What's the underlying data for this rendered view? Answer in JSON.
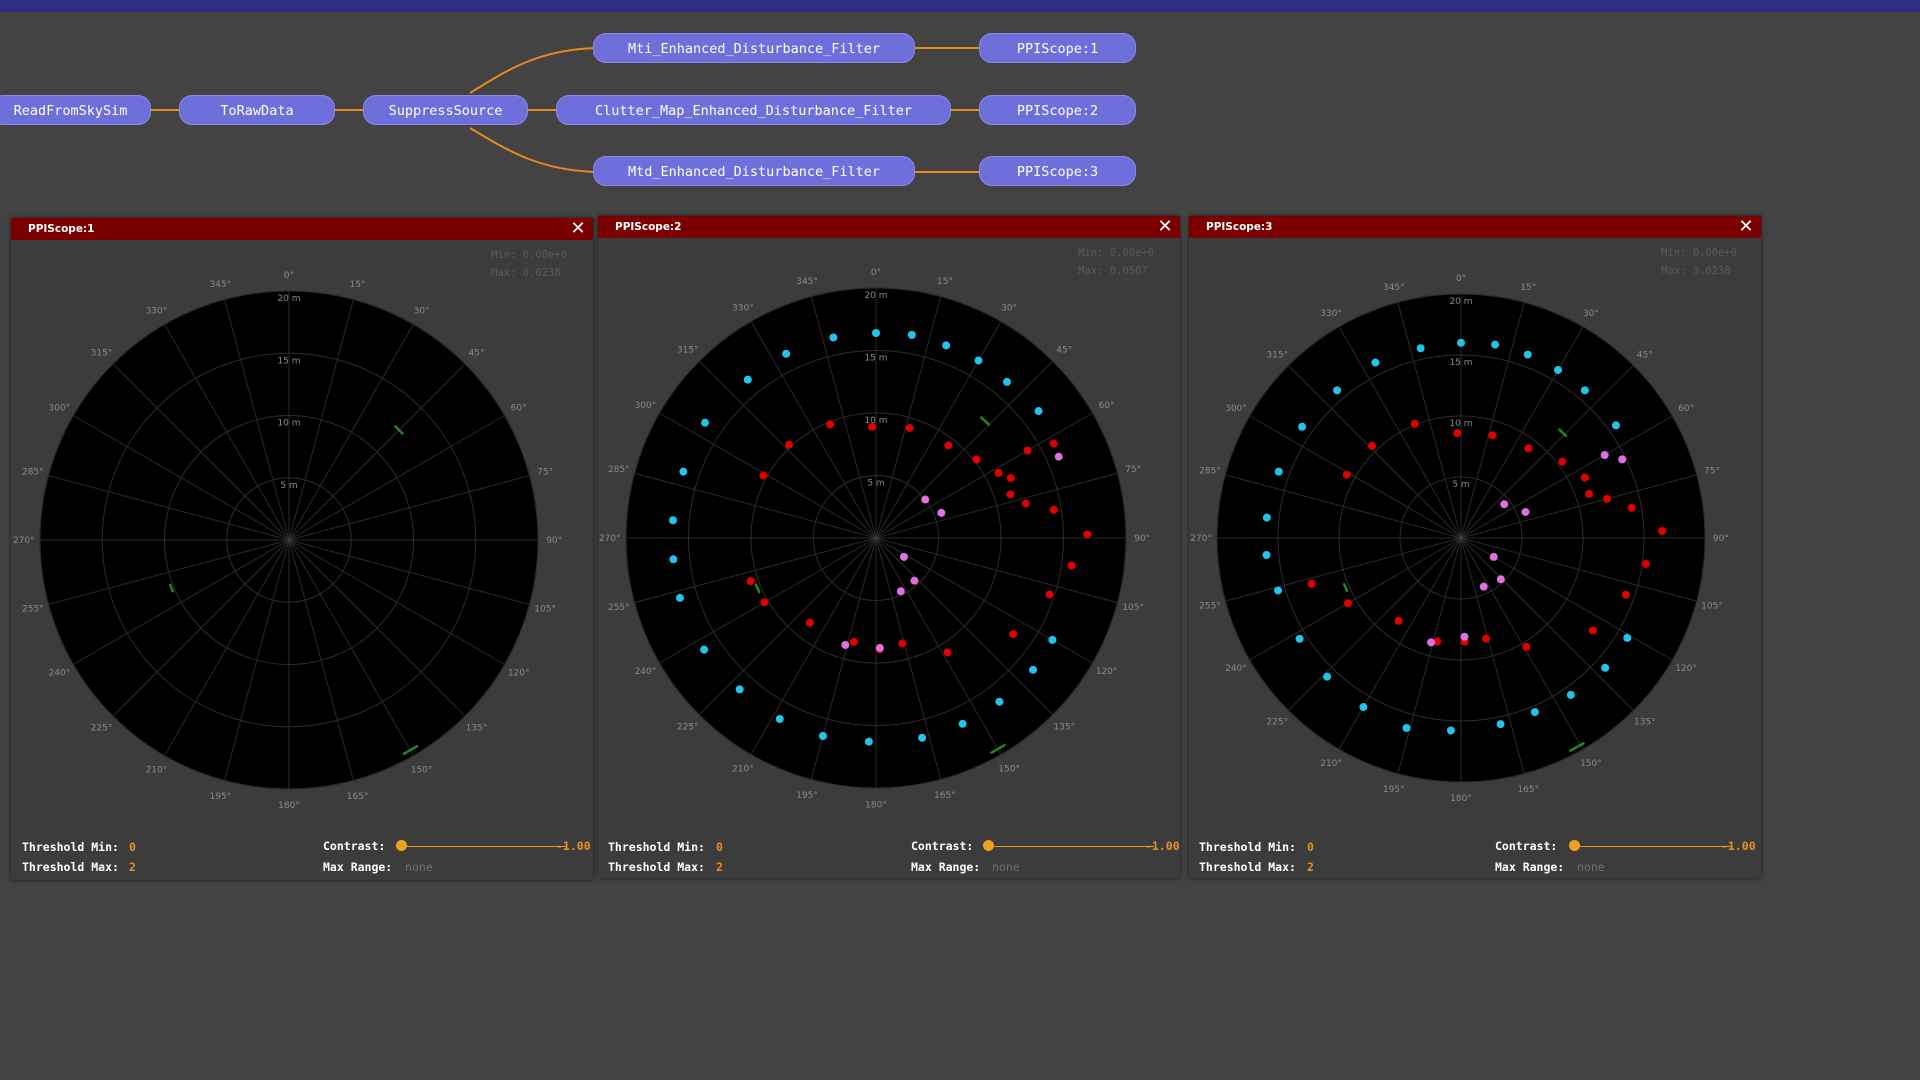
{
  "graph": {
    "nodes": {
      "read": "ReadFromSkySim",
      "toraw": "ToRawData",
      "suppress": "SuppressSource",
      "mti": "Mti_Enhanced_Disturbance_Filter",
      "clutter": "Clutter_Map_Enhanced_Disturbance_Filter",
      "mtd": "Mtd_Enhanced_Disturbance_Filter",
      "ppi1": "PPIScope:1",
      "ppi2": "PPIScope:2",
      "ppi3": "PPIScope:3"
    },
    "edge_color": "#e68a1e"
  },
  "scope_common": {
    "angle_labels": [
      "0°",
      "15°",
      "30°",
      "45°",
      "60°",
      "75°",
      "90°",
      "105°",
      "120°",
      "135°",
      "150°",
      "165°",
      "180°",
      "195°",
      "210°",
      "225°",
      "240°",
      "255°",
      "270°",
      "285°",
      "300°",
      "315°",
      "330°",
      "345°"
    ],
    "range_labels": [
      "5 m",
      "10 m",
      "15 m",
      "20 m"
    ],
    "close_glyph": "✕",
    "threshold_min_label": "Threshold Min:",
    "threshold_max_label": "Threshold Max:",
    "contrast_label": "Contrast:",
    "max_range_label": "Max Range:",
    "colors": {
      "cyan": "#22c4ec",
      "red": "#e00000",
      "magenta": "#e070e0",
      "green": "#1f8a1f"
    }
  },
  "scopes": [
    {
      "title": "PPIScope:1",
      "min_text": "Min: 0.00e+0",
      "max_text": "Max: 0.0238",
      "threshold_min": "0",
      "threshold_max": "2",
      "contrast_value": "-1.00",
      "max_range_value": "none",
      "targets": {
        "cyan": [],
        "red": [],
        "magenta": [],
        "green_streaks": [
          {
            "az": 45,
            "r": 12.5
          },
          {
            "az": 248,
            "r": 10.2
          },
          {
            "az": 150,
            "r": 19.5
          }
        ]
      }
    },
    {
      "title": "PPIScope:2",
      "min_text": "Min: 0.00e+0",
      "max_text": "Max: 0.0507",
      "threshold_min": "0",
      "threshold_max": "2",
      "contrast_value": "-1.00",
      "max_range_value": "none",
      "targets": {
        "cyan": [
          {
            "az": 0,
            "r": 16.4
          },
          {
            "az": 10,
            "r": 16.5
          },
          {
            "az": 20,
            "r": 16.4
          },
          {
            "az": 30,
            "r": 16.4
          },
          {
            "az": 40,
            "r": 16.3
          },
          {
            "az": 52,
            "r": 16.5
          },
          {
            "az": 120,
            "r": 16.3
          },
          {
            "az": 130,
            "r": 16.4
          },
          {
            "az": 143,
            "r": 16.4
          },
          {
            "az": 155,
            "r": 16.4
          },
          {
            "az": 167,
            "r": 16.4
          },
          {
            "az": 182,
            "r": 16.3
          },
          {
            "az": 195,
            "r": 16.4
          },
          {
            "az": 208,
            "r": 16.4
          },
          {
            "az": 222,
            "r": 16.3
          },
          {
            "az": 237,
            "r": 16.4
          },
          {
            "az": 253,
            "r": 16.4
          },
          {
            "az": 264,
            "r": 16.3
          },
          {
            "az": 275,
            "r": 16.3
          },
          {
            "az": 289,
            "r": 16.3
          },
          {
            "az": 304,
            "r": 16.5
          },
          {
            "az": 321,
            "r": 16.3
          },
          {
            "az": 334,
            "r": 16.4
          },
          {
            "az": 348,
            "r": 16.4
          }
        ],
        "red": [
          {
            "az": 358,
            "r": 8.9
          },
          {
            "az": 17,
            "r": 9.2
          },
          {
            "az": 38,
            "r": 9.4
          },
          {
            "az": 52,
            "r": 10.2
          },
          {
            "az": 62,
            "r": 11.1
          },
          {
            "az": 66,
            "r": 11.8
          },
          {
            "az": 72,
            "r": 11.3
          },
          {
            "az": 77,
            "r": 12.3
          },
          {
            "az": 81,
            "r": 14.4
          },
          {
            "az": 89,
            "r": 16.9
          },
          {
            "az": 98,
            "r": 15.8
          },
          {
            "az": 108,
            "r": 14.6
          },
          {
            "az": 125,
            "r": 13.4
          },
          {
            "az": 148,
            "r": 10.8
          },
          {
            "az": 166,
            "r": 8.7
          },
          {
            "az": 178,
            "r": 8.9
          },
          {
            "az": 192,
            "r": 8.5
          },
          {
            "az": 218,
            "r": 8.6
          },
          {
            "az": 240,
            "r": 10.3
          },
          {
            "az": 251,
            "r": 10.6
          },
          {
            "az": 299,
            "r": 10.3
          },
          {
            "az": 317,
            "r": 10.2
          },
          {
            "az": 338,
            "r": 9.8
          },
          {
            "az": 62,
            "r": 16.1
          },
          {
            "az": 60,
            "r": 14.0
          }
        ],
        "magenta": [
          {
            "az": 52,
            "r": 5.0
          },
          {
            "az": 69,
            "r": 5.6
          },
          {
            "az": 138,
            "r": 4.6
          },
          {
            "az": 155,
            "r": 4.7
          },
          {
            "az": 178,
            "r": 8.8
          },
          {
            "az": 196,
            "r": 8.9
          },
          {
            "az": 66,
            "r": 16.0
          },
          {
            "az": 124,
            "r": 2.7
          }
        ],
        "green_streaks": [
          {
            "az": 43,
            "r": 12.8
          },
          {
            "az": 247,
            "r": 10.3
          },
          {
            "az": 150,
            "r": 19.5
          }
        ]
      }
    },
    {
      "title": "PPIScope:3",
      "min_text": "Min: 0.00e+0",
      "max_text": "Max: 3.0238",
      "threshold_min": "0",
      "threshold_max": "2",
      "contrast_value": "-1.00",
      "max_range_value": "none",
      "targets": {
        "cyan": [
          {
            "az": 0,
            "r": 16.0
          },
          {
            "az": 10,
            "r": 16.1
          },
          {
            "az": 20,
            "r": 16.0
          },
          {
            "az": 30,
            "r": 15.9
          },
          {
            "az": 40,
            "r": 15.8
          },
          {
            "az": 54,
            "r": 15.7
          },
          {
            "az": 121,
            "r": 15.9
          },
          {
            "az": 132,
            "r": 15.9
          },
          {
            "az": 145,
            "r": 15.7
          },
          {
            "az": 157,
            "r": 15.5
          },
          {
            "az": 168,
            "r": 15.6
          },
          {
            "az": 183,
            "r": 15.8
          },
          {
            "az": 196,
            "r": 16.2
          },
          {
            "az": 210,
            "r": 16.0
          },
          {
            "az": 224,
            "r": 15.8
          },
          {
            "az": 238,
            "r": 15.6
          },
          {
            "az": 254,
            "r": 15.6
          },
          {
            "az": 265,
            "r": 16.0
          },
          {
            "az": 276,
            "r": 16.0
          },
          {
            "az": 290,
            "r": 15.9
          },
          {
            "az": 305,
            "r": 15.9
          },
          {
            "az": 320,
            "r": 15.8
          },
          {
            "az": 334,
            "r": 16.0
          },
          {
            "az": 348,
            "r": 15.9
          }
        ],
        "red": [
          {
            "az": 358,
            "r": 8.6
          },
          {
            "az": 17,
            "r": 8.8
          },
          {
            "az": 37,
            "r": 9.2
          },
          {
            "az": 53,
            "r": 10.4
          },
          {
            "az": 64,
            "r": 11.3
          },
          {
            "az": 71,
            "r": 11.1
          },
          {
            "az": 75,
            "r": 12.4
          },
          {
            "az": 80,
            "r": 14.2
          },
          {
            "az": 88,
            "r": 16.5
          },
          {
            "az": 98,
            "r": 15.3
          },
          {
            "az": 109,
            "r": 14.3
          },
          {
            "az": 125,
            "r": 13.2
          },
          {
            "az": 149,
            "r": 10.4
          },
          {
            "az": 166,
            "r": 8.5
          },
          {
            "az": 178,
            "r": 8.5
          },
          {
            "az": 193,
            "r": 8.7
          },
          {
            "az": 217,
            "r": 8.5
          },
          {
            "az": 240,
            "r": 10.7
          },
          {
            "az": 253,
            "r": 12.8
          },
          {
            "az": 299,
            "r": 10.7
          },
          {
            "az": 316,
            "r": 10.5
          },
          {
            "az": 338,
            "r": 10.1
          }
        ],
        "magenta": [
          {
            "az": 52,
            "r": 4.5
          },
          {
            "az": 68,
            "r": 5.7
          },
          {
            "az": 136,
            "r": 4.7
          },
          {
            "az": 155,
            "r": 4.4
          },
          {
            "az": 178,
            "r": 8.1
          },
          {
            "az": 196,
            "r": 8.9
          },
          {
            "az": 60,
            "r": 13.6
          },
          {
            "az": 64,
            "r": 14.7
          },
          {
            "az": 120,
            "r": 3.1
          }
        ],
        "green_streaks": [
          {
            "az": 44,
            "r": 12.0
          },
          {
            "az": 247,
            "r": 10.3
          },
          {
            "az": 151,
            "r": 19.6
          }
        ]
      }
    }
  ]
}
